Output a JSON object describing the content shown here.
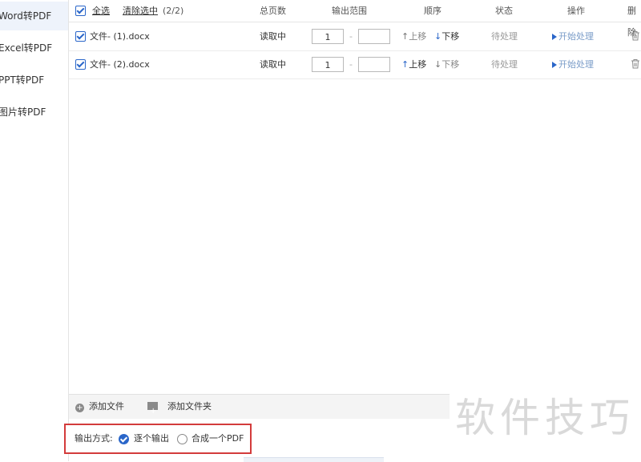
{
  "sidebar": {
    "items": [
      {
        "label": "Word转PDF",
        "active": true
      },
      {
        "label": "Excel转PDF",
        "active": false
      },
      {
        "label": "PPT转PDF",
        "active": false
      },
      {
        "label": "图片转PDF",
        "active": false
      }
    ]
  },
  "header": {
    "select_all": "全选",
    "clear_selected": "清除选中",
    "count": "(2/2)",
    "col_pages": "总页数",
    "col_range": "输出范围",
    "col_order": "顺序",
    "col_status": "状态",
    "col_action": "操作",
    "col_delete": "删除"
  },
  "rows": [
    {
      "name": "文件- (1).docx",
      "pages": "读取中",
      "range_from": "1",
      "range_to": "",
      "dash": "-",
      "up": "上移",
      "down": "下移",
      "status": "待处理",
      "action": "开始处理"
    },
    {
      "name": "文件- (2).docx",
      "pages": "读取中",
      "range_from": "1",
      "range_to": "",
      "dash": "-",
      "up": "上移",
      "down": "下移",
      "status": "待处理",
      "action": "开始处理"
    }
  ],
  "bottom": {
    "add_file": "添加文件",
    "add_folder": "添加文件夹"
  },
  "output": {
    "label": "输出方式:",
    "option_individual": "逐个输出",
    "option_merge": "合成一个PDF",
    "selected": "逐个输出"
  },
  "watermark": "软件技巧",
  "colors": {
    "accent": "#2a66c9",
    "highlight_border": "#d33b3b"
  }
}
